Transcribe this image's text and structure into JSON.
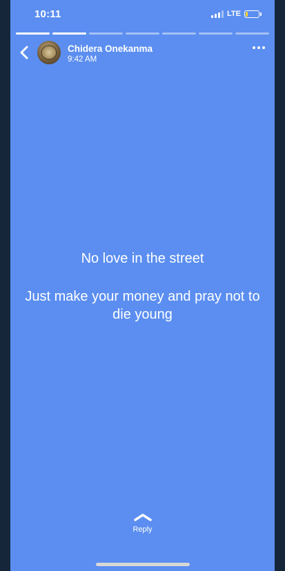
{
  "status_bar": {
    "time": "10:11",
    "network": "LTE",
    "signal_bars": 3,
    "battery_level": 0.15,
    "battery_color": "#f5d032"
  },
  "progress": {
    "segments": [
      1,
      1,
      0,
      0,
      0,
      0,
      0
    ]
  },
  "header": {
    "back_icon": "chevron-left-icon",
    "name": "Chidera Onekanma",
    "time": "9:42 AM",
    "more_icon": "more-horizontal-icon"
  },
  "story": {
    "background_color": "#5b8ef0",
    "line1": "No love in the street",
    "line2": "Just make your money and pray not to die young"
  },
  "reply": {
    "icon": "chevron-up-icon",
    "label": "Reply"
  }
}
